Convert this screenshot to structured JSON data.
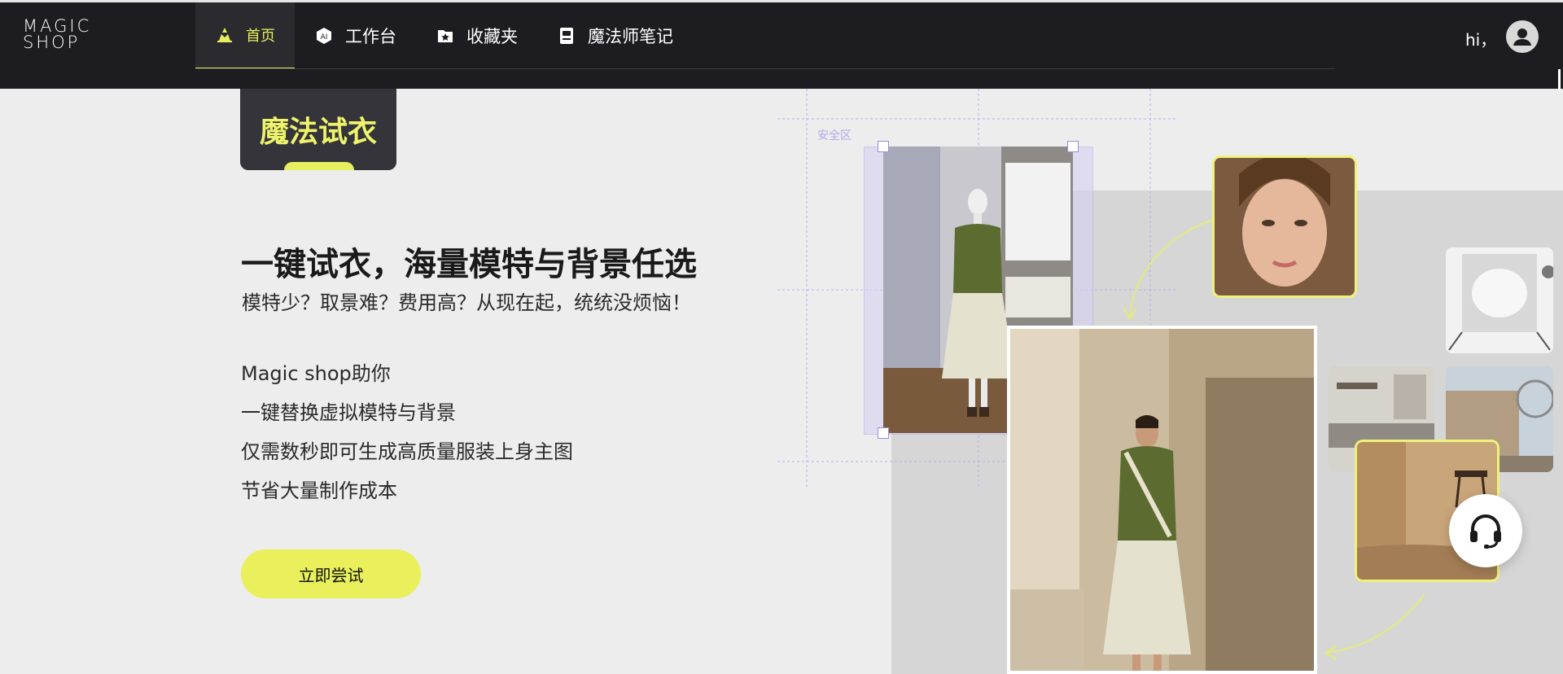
{
  "brand": {
    "line1": "MAGIC",
    "line2": "SHOP",
    "accent": "#e7ef5e"
  },
  "nav": {
    "items": [
      {
        "label": "首页",
        "icon": "home-icon",
        "active": true
      },
      {
        "label": "工作台",
        "icon": "ai-icon",
        "active": false
      },
      {
        "label": "收藏夹",
        "icon": "favorites-icon",
        "active": false
      },
      {
        "label": "魔法师笔记",
        "icon": "notes-icon",
        "active": false
      }
    ]
  },
  "user": {
    "greeting": "hi，",
    "avatar_icon": "user-icon"
  },
  "hero": {
    "badge": "魔法试衣",
    "headline": "一键试衣，海量模特与背景任选",
    "subline": "模特少？取景难？费用高？从现在起，统统没烦恼！",
    "features": [
      "Magic shop助你",
      "一键替换虚拟模特与背景",
      "仅需数秒即可生成高质量服装上身主图",
      "节省大量制作成本"
    ],
    "cta": "立即尝试"
  },
  "editor": {
    "safe_area_label": "安全区"
  },
  "support": {
    "icon": "headset-icon"
  }
}
